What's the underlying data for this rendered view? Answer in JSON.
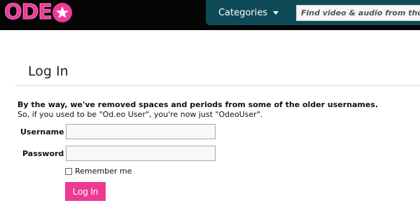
{
  "header": {
    "logo_text": "ODE",
    "logo_star": "★",
    "categories_label": "Categories",
    "search_placeholder": "Find video & audio from thousands of"
  },
  "main": {
    "title": "Log In",
    "notice_line1": "By the way, we've removed spaces and periods from some of the older usernames.",
    "notice_line2": "So, if you used to be \"Od.eo User\", you're now just \"OdeoUser\".",
    "username_label": "Username",
    "username_value": "",
    "password_label": "Password",
    "password_value": "",
    "remember_label": "Remember me",
    "remember_checked": false,
    "login_button": "Log In"
  },
  "colors": {
    "brand_pink": "#ec3b92",
    "nav_teal": "#0e4a55",
    "topbar_black": "#050505"
  }
}
